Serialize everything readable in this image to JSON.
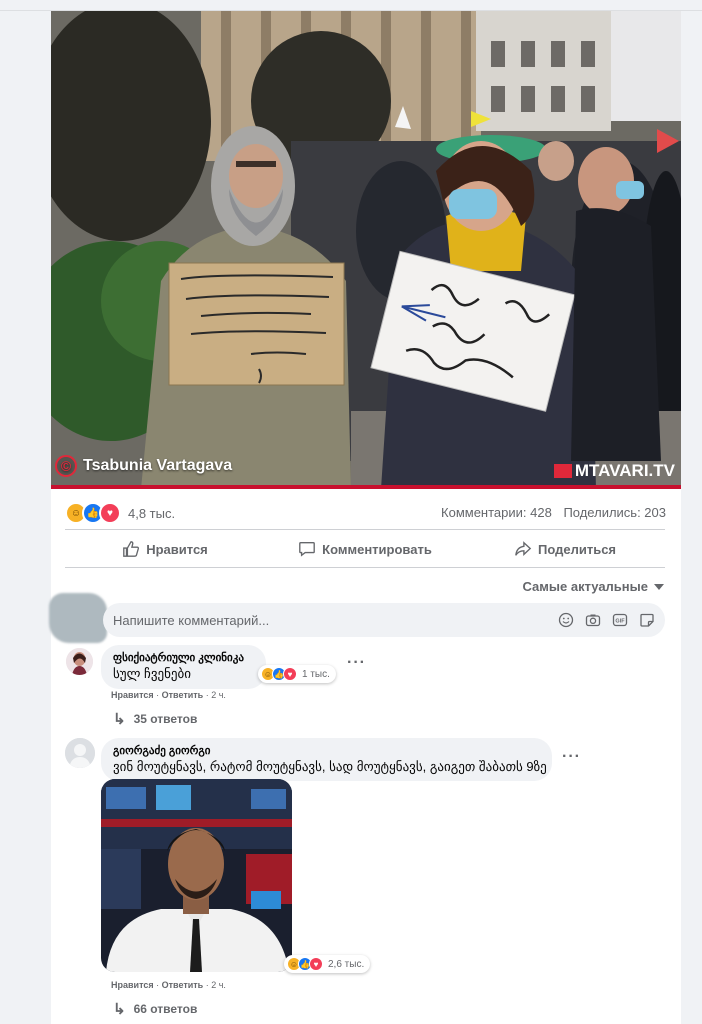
{
  "post": {
    "photo_credit": "Tsabunia Vartagava",
    "photo_brand": "MTAVARI.TV",
    "reactions_count": "4,8 тыс.",
    "comments_count": "Комментарии: 428",
    "shares_count": "Поделились: 203"
  },
  "actions": {
    "like": "Нравится",
    "comment": "Комментировать",
    "share": "Поделиться"
  },
  "sort_label": "Самые актуальные",
  "comment_input": {
    "placeholder": "Напишите комментарий..."
  },
  "comments": [
    {
      "author": "ფსიქიატრიული კლინიკა",
      "text": "სულ ჩვენები",
      "reactions": "1 тыс.",
      "like": "Нравится",
      "reply": "Ответить",
      "time": "2 ч.",
      "replies": "35 ответов"
    },
    {
      "author": "გიორგაძე გიორგი",
      "text": "ვინ მოუტყნავს, რატომ მოუტყნავს, სად მოუტყნავს, გაიგეთ შაბათს 9ზე",
      "reactions": "2,6 тыс.",
      "like": "Нравится",
      "reply": "Ответить",
      "time": "2 ч.",
      "replies": "66 ответов"
    }
  ],
  "colors": {
    "brand_red": "#c8102e",
    "like_blue": "#1877f2",
    "love_red": "#f33e58",
    "haha_yellow": "#f7b125",
    "muted_text": "#65676b"
  }
}
